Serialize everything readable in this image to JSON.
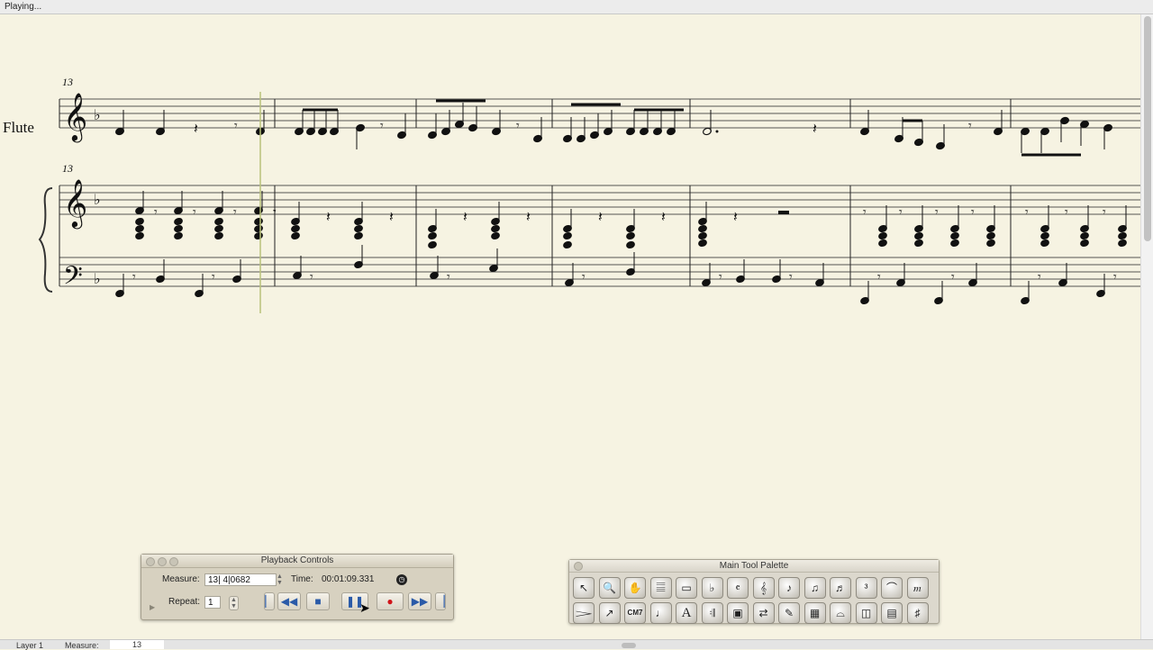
{
  "status": {
    "text": "Playing..."
  },
  "score": {
    "instrument": "Flute",
    "measure_number_flute": "13",
    "measure_number_piano": "13"
  },
  "playback": {
    "title": "Playback Controls",
    "measure_label": "Measure:",
    "measure_value": "13| 4|0682",
    "time_label": "Time:",
    "time_value": "00:01:09.331",
    "repeat_label": "Repeat:",
    "repeat_value": "1",
    "buttons": [
      "start-button",
      "rewind-button",
      "stop-button",
      "pause-button",
      "record-button",
      "fast-forward-button",
      "end-button"
    ],
    "accent": "#2a5aa8",
    "record_color": "#d0141a"
  },
  "palette": {
    "title": "Main Tool Palette",
    "tools_row1": [
      "selection-icon",
      "zoom-icon",
      "hand-icon",
      "staff-icon",
      "measure-icon",
      "key-signature-icon",
      "time-signature-icon",
      "clef-icon",
      "simple-entry-icon",
      "speedy-entry-icon",
      "hyperscribe-icon",
      "tuplet-icon",
      "smart-shape-icon",
      "expression-icon"
    ],
    "tools_row2": [
      "articulation-icon",
      "note-mover-icon",
      "chord-icon",
      "lyrics-icon",
      "text-icon",
      "repeat-icon",
      "graphics-icon",
      "mirror-icon",
      "special-tools-icon",
      "mass-edit-icon",
      "resize-icon",
      "ossia-icon",
      "page-layout-icon",
      "transpose-icon"
    ],
    "row2_labels": {
      "chord": "CM7",
      "text": "A"
    }
  },
  "bottombar": {
    "layer": "Layer 1",
    "measure_label": "Measure:",
    "measure_value": "13"
  }
}
